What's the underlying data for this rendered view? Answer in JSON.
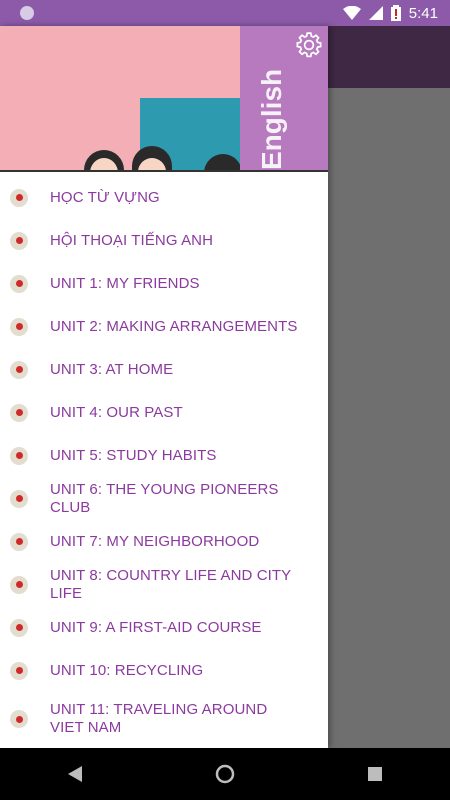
{
  "status_bar": {
    "time": "5:41",
    "icons": [
      "notification-dot-icon",
      "wifi-icon",
      "cellular-icon",
      "battery-alert-icon"
    ]
  },
  "drawer": {
    "header": {
      "book_text": "English",
      "settings_icon": "gear-icon"
    },
    "items": [
      {
        "label": "HỌC TỪ VỰNG"
      },
      {
        "label": "HỘI THOẠI TIẾNG ANH"
      },
      {
        "label": "UNIT 1: MY FRIENDS"
      },
      {
        "label": "UNIT 2: MAKING ARRANGEMENTS"
      },
      {
        "label": "UNIT 3: AT HOME"
      },
      {
        "label": "UNIT 4: OUR PAST"
      },
      {
        "label": "UNIT 5: STUDY HABITS"
      },
      {
        "label": "UNIT 6: THE YOUNG PIONEERS CLUB"
      },
      {
        "label": "UNIT 7: MY NEIGHBORHOOD"
      },
      {
        "label": "UNIT 8: COUNTRY LIFE AND CITY LIFE"
      },
      {
        "label": "UNIT 9: A FIRST-AID COURSE"
      },
      {
        "label": "UNIT 10: RECYCLING"
      },
      {
        "label": "UNIT 11: TRAVELING AROUND VIET NAM"
      }
    ]
  },
  "nav_bar": {
    "buttons": [
      "back-icon",
      "home-icon",
      "recents-icon"
    ]
  },
  "colors": {
    "status_bar": "#8c5aa8",
    "toolbar": "#3e2843",
    "menu_text": "#8b3a9e",
    "bullet_dot": "#cf2a2a"
  }
}
